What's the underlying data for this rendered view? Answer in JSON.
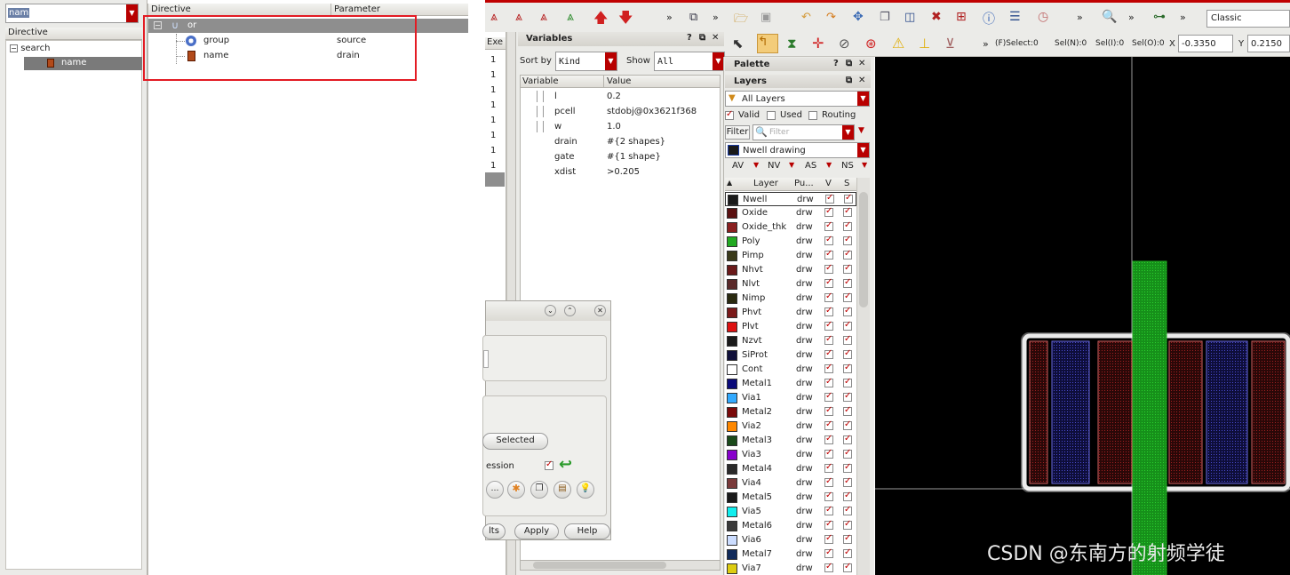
{
  "search_panel": {
    "search_value": "nam",
    "header": "Directive",
    "tree_root": "search",
    "tree_child": "name"
  },
  "directive_panel": {
    "col_directive": "Directive",
    "col_parameter": "Parameter",
    "rows": [
      {
        "directive": "or",
        "parameter": ""
      },
      {
        "directive": "group",
        "parameter": "source"
      },
      {
        "directive": "name",
        "parameter": "drain"
      }
    ]
  },
  "exe_panel": {
    "header": "Exe",
    "values": [
      "1",
      "1",
      "1",
      "1",
      "1",
      "1",
      "1",
      "1"
    ]
  },
  "variables": {
    "title": "Variables",
    "sort_by_label": "Sort by",
    "sort_by_value": "Kind",
    "show_label": "Show",
    "show_value": "All",
    "col_variable": "Variable",
    "col_value": "Value",
    "rows": [
      {
        "name": "l",
        "value": "0.2"
      },
      {
        "name": "pcell",
        "value": "stdobj@0x3621f368"
      },
      {
        "name": "w",
        "value": "1.0"
      },
      {
        "name": "drain",
        "value": "#{2 shapes}"
      },
      {
        "name": "gate",
        "value": "#{1 shape}"
      },
      {
        "name": "xdist",
        "value": ">0.205"
      }
    ]
  },
  "dialog": {
    "selected_label": "Selected",
    "session_label": "ession",
    "results_label": "lts",
    "apply_label": "Apply",
    "help_label": "Help"
  },
  "palette": {
    "title": "Palette"
  },
  "layers": {
    "title": "Layers",
    "filter_set": "All Layers",
    "valid_label": "Valid",
    "used_label": "Used",
    "routing_label": "Routing",
    "filter_label": "Filter",
    "filter_placeholder": "Filter",
    "current_layer": "Nwell drawing",
    "vis_buttons": [
      "AV",
      "NV",
      "AS",
      "NS"
    ],
    "col_layer": "Layer",
    "col_purpose": "Pu...",
    "col_v": "V",
    "col_s": "S",
    "rows": [
      {
        "name": "Nwell",
        "purpose": "drw",
        "color": "#1a1a1a"
      },
      {
        "name": "Oxide",
        "purpose": "drw",
        "color": "#5a1010"
      },
      {
        "name": "Oxide_thk",
        "purpose": "drw",
        "color": "#8a2020"
      },
      {
        "name": "Poly",
        "purpose": "drw",
        "color": "#22aa22"
      },
      {
        "name": "Pimp",
        "purpose": "drw",
        "color": "#3a3a1a"
      },
      {
        "name": "Nhvt",
        "purpose": "drw",
        "color": "#6a1a1a"
      },
      {
        "name": "Nlvt",
        "purpose": "drw",
        "color": "#5a2a2a"
      },
      {
        "name": "Nimp",
        "purpose": "drw",
        "color": "#2a2a10"
      },
      {
        "name": "Phvt",
        "purpose": "drw",
        "color": "#7a1a1a"
      },
      {
        "name": "Plvt",
        "purpose": "drw",
        "color": "#dd1111"
      },
      {
        "name": "Nzvt",
        "purpose": "drw",
        "color": "#1a1a1a"
      },
      {
        "name": "SiProt",
        "purpose": "drw",
        "color": "#10103a"
      },
      {
        "name": "Cont",
        "purpose": "drw",
        "color": "#ffffff"
      },
      {
        "name": "Metal1",
        "purpose": "drw",
        "color": "#0a0a7a"
      },
      {
        "name": "Via1",
        "purpose": "drw",
        "color": "#33aaff"
      },
      {
        "name": "Metal2",
        "purpose": "drw",
        "color": "#7a0a0a"
      },
      {
        "name": "Via2",
        "purpose": "drw",
        "color": "#ff8800"
      },
      {
        "name": "Metal3",
        "purpose": "drw",
        "color": "#1a4a1a"
      },
      {
        "name": "Via3",
        "purpose": "drw",
        "color": "#8800cc"
      },
      {
        "name": "Metal4",
        "purpose": "drw",
        "color": "#2a2a2a"
      },
      {
        "name": "Via4",
        "purpose": "drw",
        "color": "#7a3a3a"
      },
      {
        "name": "Metal5",
        "purpose": "drw",
        "color": "#1a1a1a"
      },
      {
        "name": "Via5",
        "purpose": "drw",
        "color": "#11eeee"
      },
      {
        "name": "Metal6",
        "purpose": "drw",
        "color": "#3a3a3a"
      },
      {
        "name": "Via6",
        "purpose": "drw",
        "color": "#ccddff"
      },
      {
        "name": "Metal7",
        "purpose": "drw",
        "color": "#102a5a"
      },
      {
        "name": "Via7",
        "purpose": "drw",
        "color": "#ddcc11"
      }
    ]
  },
  "status": {
    "fselect": "(F)Select:0",
    "seln": "Sel(N):0",
    "seli": "Sel(I):0",
    "selo": "Sel(O):0",
    "x_label": "X",
    "x_value": "-0.3350",
    "y_label": "Y",
    "y_value": "0.2150"
  },
  "toolbar": {
    "workspace": "Classic"
  },
  "watermark": "CSDN @东南方的射频学徒",
  "colors": {
    "highlight_red": "#e31b23",
    "poly_green": "#1fa31f",
    "canvas_bg": "#000000"
  }
}
